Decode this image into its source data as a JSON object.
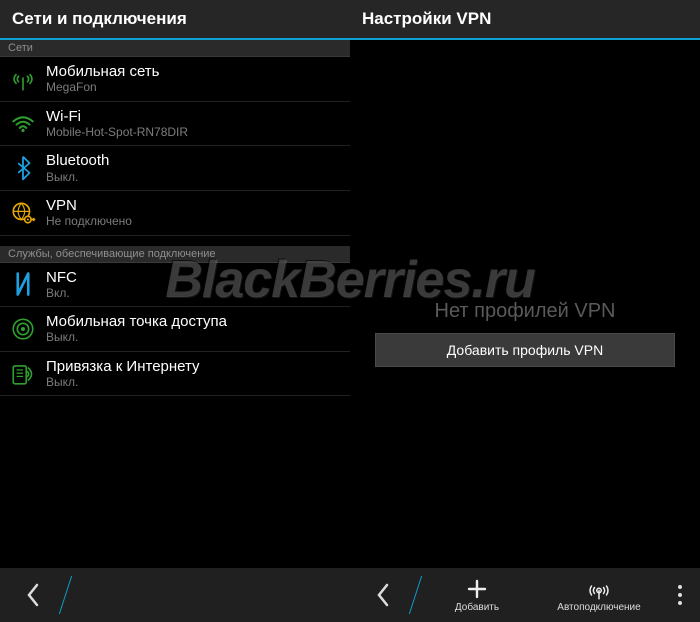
{
  "watermark": "BlackBerries.ru",
  "left": {
    "title": "Сети и подключения",
    "sections": [
      {
        "header": "Сети",
        "items": [
          {
            "icon": "cellular-icon",
            "title": "Мобильная сеть",
            "sub": "MegaFon"
          },
          {
            "icon": "wifi-icon",
            "title": "Wi-Fi",
            "sub": "Mobile-Hot-Spot-RN78DIR"
          },
          {
            "icon": "bluetooth-icon",
            "title": "Bluetooth",
            "sub": "Выкл."
          },
          {
            "icon": "vpn-icon",
            "title": "VPN",
            "sub": "Не подключено"
          }
        ]
      },
      {
        "header": "Службы, обеспечивающие подключение",
        "items": [
          {
            "icon": "nfc-icon",
            "title": "NFC",
            "sub": "Вкл."
          },
          {
            "icon": "hotspot-icon",
            "title": "Мобильная точка доступа",
            "sub": "Выкл."
          },
          {
            "icon": "tether-icon",
            "title": "Привязка к Интернету",
            "sub": "Выкл."
          }
        ]
      }
    ],
    "back_label": "Назад"
  },
  "right": {
    "title": "Настройки VPN",
    "empty_title": "Нет профилей VPN",
    "add_button": "Добавить профиль VPN",
    "toolbar": {
      "add": "Добавить",
      "autoconnect": "Автоподключение"
    },
    "back_label": "Назад"
  }
}
